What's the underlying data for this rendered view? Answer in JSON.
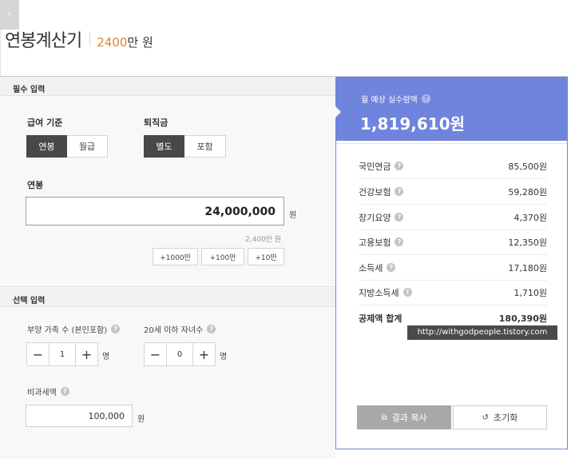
{
  "back_icon": "chevron-left-icon",
  "header": {
    "title": "연봉계산기",
    "subtitle_number": "2400",
    "subtitle_unit": "만 원"
  },
  "required": {
    "section_title": "필수 입력",
    "pay_basis": {
      "label": "급여 기준",
      "options": [
        "연봉",
        "월급"
      ],
      "selected": "연봉"
    },
    "severance": {
      "label": "퇴직금",
      "options": [
        "별도",
        "포함"
      ],
      "selected": "별도"
    },
    "salary": {
      "label": "연봉",
      "value": "24,000,000",
      "unit": "원",
      "hint": "2,400만 원"
    },
    "quick_add": [
      "+1000만",
      "+100만",
      "+10만"
    ]
  },
  "optional": {
    "section_title": "선택 입력",
    "dependents": {
      "label": "부양 가족 수 (본인포함)",
      "value": "1",
      "unit": "명"
    },
    "children": {
      "label": "20세 이하 자녀수",
      "value": "0",
      "unit": "명"
    },
    "nontax": {
      "label": "비과세액",
      "value": "100,000",
      "unit": "원"
    }
  },
  "result": {
    "label": "월 예상 실수령액",
    "amount": "1,819,610원",
    "deductions": [
      {
        "name": "국민연금",
        "value": "85,500원"
      },
      {
        "name": "건강보험",
        "value": "59,280원"
      },
      {
        "name": "장기요양",
        "value": "4,370원"
      },
      {
        "name": "고용보험",
        "value": "12,350원"
      },
      {
        "name": "소득세",
        "value": "17,180원"
      },
      {
        "name": "지방소득세",
        "value": "1,710원"
      }
    ],
    "total": {
      "name": "공제액 합계",
      "value": "180,390원"
    },
    "copy_button": "결과 복사",
    "reset_button": "초기화"
  },
  "watermark": "http://withgodpeople.tistory.com",
  "colors": {
    "accent": "#6f84dd",
    "orange": "#e5802a",
    "selected": "#484848"
  }
}
